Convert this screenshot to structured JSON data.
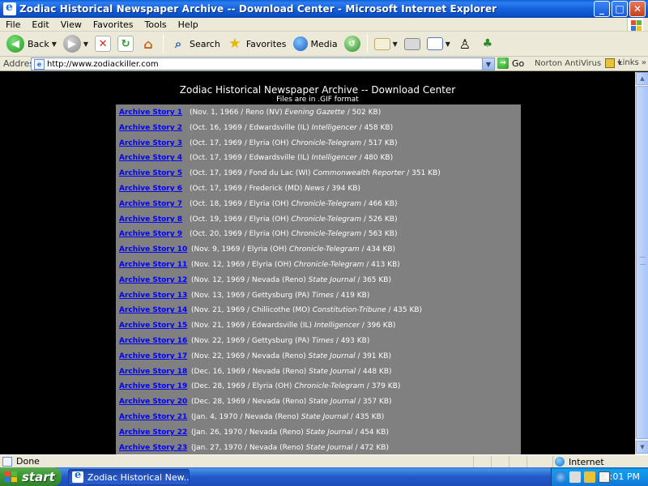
{
  "window": {
    "title": "Zodiac Historical Newspaper Archive -- Download Center - Microsoft Internet Explorer",
    "buttons": {
      "minimize": "_",
      "maximize": "□",
      "close": "✕"
    }
  },
  "menu": [
    "File",
    "Edit",
    "View",
    "Favorites",
    "Tools",
    "Help"
  ],
  "toolbar": {
    "back": "Back",
    "search": "Search",
    "favorites": "Favorites",
    "media": "Media"
  },
  "address": {
    "label": "Address",
    "url": "http://www.zodiackiller.com",
    "go": "Go",
    "norton": "Norton AntiVirus",
    "links": "Links"
  },
  "page": {
    "heading": "Zodiac Historical Newspaper Archive -- Download Center",
    "subheading": "Files are in .GIF format",
    "stories": [
      {
        "link": "Archive Story 1",
        "pre": "(Nov. 1, 1966 / Reno (NV) ",
        "paper": "Evening Gazette",
        "post": " / 502 KB)"
      },
      {
        "link": "Archive Story 2",
        "pre": "(Oct. 16, 1969 / Edwardsville (IL) ",
        "paper": "Intelligencer",
        "post": " / 458 KB)"
      },
      {
        "link": "Archive Story 3",
        "pre": "(Oct. 17, 1969 / Elyria (OH) ",
        "paper": "Chronicle-Telegram",
        "post": " / 517 KB)"
      },
      {
        "link": "Archive Story 4",
        "pre": "(Oct. 17, 1969 / Edwardsville (IL) ",
        "paper": "Intelligencer",
        "post": " / 480 KB)"
      },
      {
        "link": "Archive Story 5",
        "pre": "(Oct. 17, 1969 / Fond du Lac (WI) ",
        "paper": "Commonwealth Reporter",
        "post": " / 351 KB)"
      },
      {
        "link": "Archive Story 6",
        "pre": "(Oct. 17, 1969 / Frederick (MD) ",
        "paper": "News",
        "post": " / 394 KB)"
      },
      {
        "link": "Archive Story 7",
        "pre": "(Oct. 18, 1969 / Elyria (OH) ",
        "paper": "Chronicle-Telegram",
        "post": " / 466 KB)"
      },
      {
        "link": "Archive Story 8",
        "pre": "(Oct. 19, 1969 / Elyria (OH) ",
        "paper": "Chronicle-Telegram",
        "post": " / 526 KB)"
      },
      {
        "link": "Archive Story 9",
        "pre": "(Oct. 20, 1969 / Elyria (OH) ",
        "paper": "Chronicle-Telegram",
        "post": " / 563 KB)"
      },
      {
        "link": "Archive Story 10",
        "pre": "(Nov. 9, 1969 / Elyria (OH) ",
        "paper": "Chronicle-Telegram",
        "post": " / 434 KB)"
      },
      {
        "link": "Archive Story 11",
        "pre": "(Nov. 12, 1969 / Elyria (OH) ",
        "paper": "Chronicle-Telegram",
        "post": " / 413 KB)"
      },
      {
        "link": "Archive Story 12",
        "pre": "(Nov. 12, 1969 / Nevada (Reno) ",
        "paper": "State Journal",
        "post": " / 365 KB)"
      },
      {
        "link": "Archive Story 13",
        "pre": "(Nov. 13, 1969 / Gettysburg (PA) ",
        "paper": "Times",
        "post": " / 419 KB)"
      },
      {
        "link": "Archive Story 14",
        "pre": "(Nov. 21, 1969 / Chillicothe (MO) ",
        "paper": "Constitution-Tribune",
        "post": " / 435 KB)"
      },
      {
        "link": "Archive Story 15",
        "pre": "(Nov. 21, 1969 / Edwardsville (IL) ",
        "paper": "Intelligencer",
        "post": " / 396 KB)"
      },
      {
        "link": "Archive Story 16",
        "pre": "(Nov. 22, 1969 / Gettysburg (PA) ",
        "paper": "Times",
        "post": " / 493 KB)"
      },
      {
        "link": "Archive Story 17",
        "pre": "(Nov. 22, 1969 / Nevada (Reno) ",
        "paper": "State Journal",
        "post": " / 391 KB)"
      },
      {
        "link": "Archive Story 18",
        "pre": "(Dec. 16, 1969 / Nevada (Reno) ",
        "paper": "State Journal",
        "post": " / 448 KB)"
      },
      {
        "link": "Archive Story 19",
        "pre": "(Dec. 28, 1969 / Elyria (OH) ",
        "paper": "Chronicle-Telegram",
        "post": " / 379 KB)"
      },
      {
        "link": "Archive Story 20",
        "pre": "(Dec. 28, 1969 / Nevada (Reno) ",
        "paper": "State Journal",
        "post": " / 357 KB)"
      },
      {
        "link": "Archive Story 21",
        "pre": "(Jan. 4, 1970 / Nevada (Reno) ",
        "paper": "State Journal",
        "post": " / 435 KB)"
      },
      {
        "link": "Archive Story 22",
        "pre": "(Jan. 26, 1970 / Nevada (Reno) ",
        "paper": "State Journal",
        "post": " / 454 KB)"
      },
      {
        "link": "Archive Story 23",
        "pre": "(Jan. 27, 1970 / Nevada (Reno) ",
        "paper": "State Journal",
        "post": " / 472 KB)"
      }
    ]
  },
  "status": {
    "text": "Done",
    "zone": "Internet"
  },
  "taskbar": {
    "start": "start",
    "task": "Zodiac Historical New...",
    "clock": "4:01 PM"
  },
  "colors": {
    "link": "#0000ff",
    "table_bg": "#808080",
    "page_bg": "#000000"
  }
}
